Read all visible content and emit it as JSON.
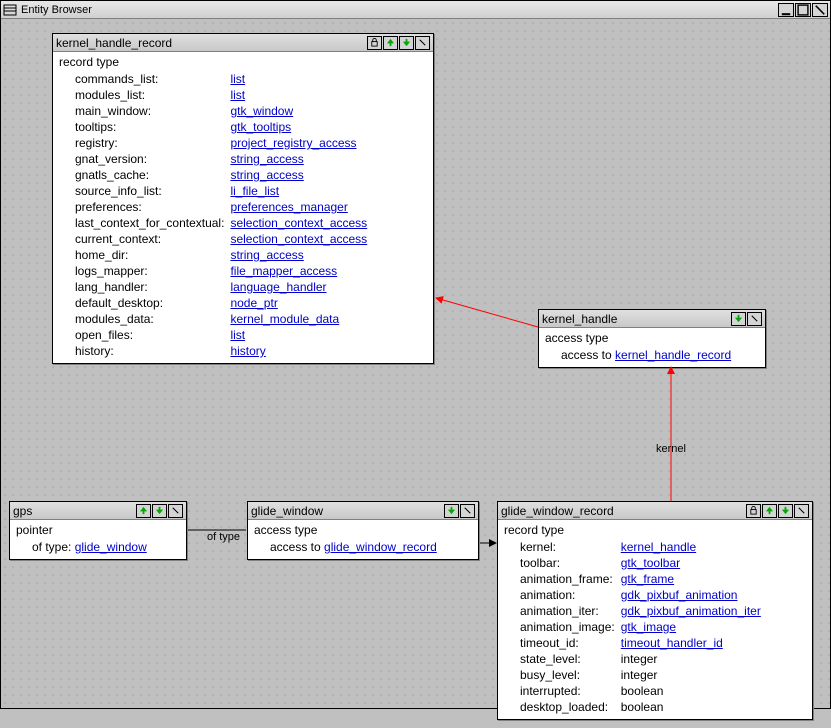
{
  "window": {
    "title": "Entity Browser"
  },
  "entities": {
    "kernel_handle_record": {
      "title": "kernel_handle_record",
      "typeline": "record type",
      "fields": [
        {
          "name": "commands_list:",
          "type": "list",
          "link": true
        },
        {
          "name": "modules_list:",
          "type": "list",
          "link": true
        },
        {
          "name": "main_window:",
          "type": "gtk_window",
          "link": true
        },
        {
          "name": "tooltips:",
          "type": "gtk_tooltips",
          "link": true
        },
        {
          "name": "registry:",
          "type": "project_registry_access",
          "link": true
        },
        {
          "name": "gnat_version:",
          "type": "string_access",
          "link": true
        },
        {
          "name": "gnatls_cache:",
          "type": "string_access",
          "link": true
        },
        {
          "name": "source_info_list:",
          "type": "li_file_list",
          "link": true
        },
        {
          "name": "preferences:",
          "type": "preferences_manager",
          "link": true
        },
        {
          "name": "last_context_for_contextual:",
          "type": "selection_context_access",
          "link": true
        },
        {
          "name": "current_context:",
          "type": "selection_context_access",
          "link": true
        },
        {
          "name": "home_dir:",
          "type": "string_access",
          "link": true
        },
        {
          "name": "logs_mapper:",
          "type": "file_mapper_access",
          "link": true
        },
        {
          "name": "lang_handler:",
          "type": "language_handler",
          "link": true
        },
        {
          "name": "default_desktop:",
          "type": "node_ptr",
          "link": true
        },
        {
          "name": "modules_data:",
          "type": "kernel_module_data",
          "link": true
        },
        {
          "name": "open_files:",
          "type": "list",
          "link": true
        },
        {
          "name": "history:",
          "type": "history",
          "link": true
        }
      ]
    },
    "kernel_handle": {
      "title": "kernel_handle",
      "typeline": "access type",
      "access_prefix": "access to ",
      "access_target": "kernel_handle_record"
    },
    "gps": {
      "title": "gps",
      "typeline": "pointer",
      "of_prefix": "of type: ",
      "of_target": "glide_window"
    },
    "glide_window": {
      "title": "glide_window",
      "typeline": "access type",
      "access_prefix": "access to ",
      "access_target": "glide_window_record"
    },
    "glide_window_record": {
      "title": "glide_window_record",
      "typeline": "record type",
      "fields": [
        {
          "name": "kernel:",
          "type": "kernel_handle",
          "link": true
        },
        {
          "name": "toolbar:",
          "type": "gtk_toolbar",
          "link": true
        },
        {
          "name": "animation_frame:",
          "type": "gtk_frame",
          "link": true
        },
        {
          "name": "animation:",
          "type": "gdk_pixbuf_animation",
          "link": true
        },
        {
          "name": "animation_iter:",
          "type": "gdk_pixbuf_animation_iter",
          "link": true
        },
        {
          "name": "animation_image:",
          "type": "gtk_image",
          "link": true
        },
        {
          "name": "timeout_id:",
          "type": "timeout_handler_id",
          "link": true
        },
        {
          "name": "state_level:",
          "type": "integer",
          "link": false
        },
        {
          "name": "busy_level:",
          "type": "integer",
          "link": false
        },
        {
          "name": "interrupted:",
          "type": "boolean",
          "link": false
        },
        {
          "name": "desktop_loaded:",
          "type": "boolean",
          "link": false
        }
      ]
    }
  },
  "edges": {
    "of_type": "of type",
    "kernel": "kernel"
  }
}
